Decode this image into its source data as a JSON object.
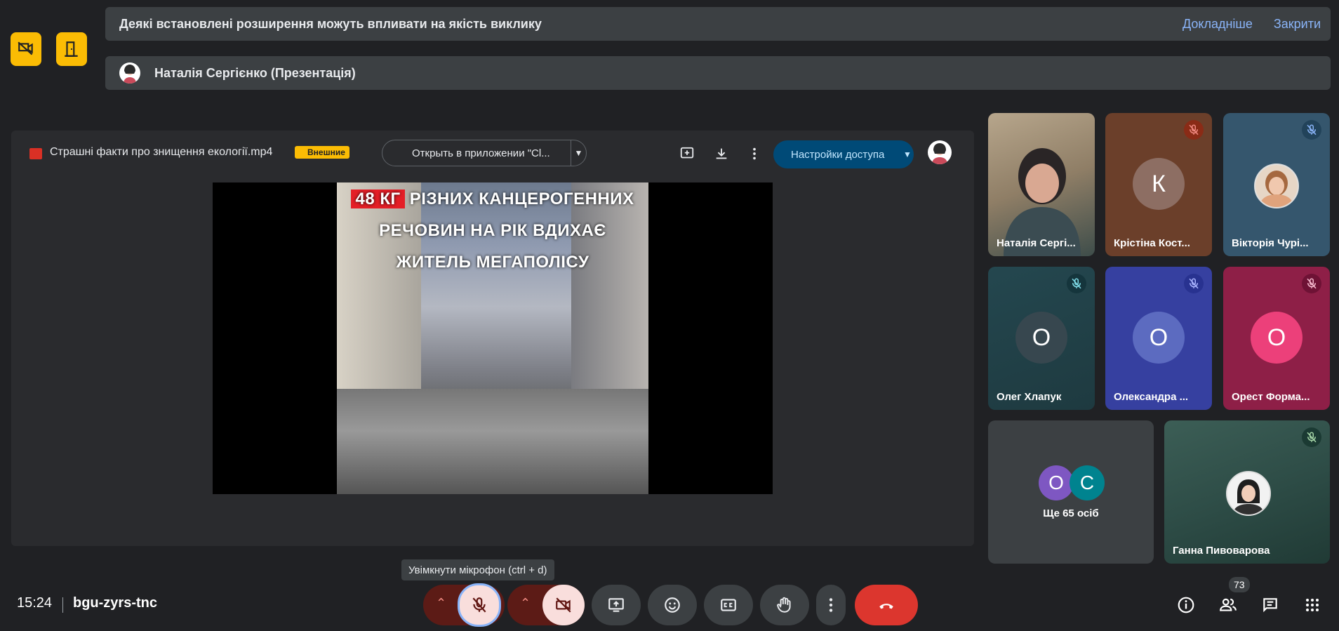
{
  "warning_banner": {
    "text": "Деякі встановлені розширення можуть впливати на якість виклику",
    "learn_more": "Докладніше",
    "close": "Закрити"
  },
  "presenter_banner": {
    "text": "Наталія Сергієнко (Презентація)"
  },
  "presentation": {
    "file_name": "Страшні факти про знищення екології.mp4",
    "badge": "Внешние",
    "open_app": "Открыть в приложении \"Cl...",
    "share_button": "Настройки доступа",
    "video_text": {
      "highlight": "48 КГ",
      "line1_rest": "РІЗНИХ КАНЦЕРОГЕННИХ",
      "line2": "РЕЧОВИН НА РІК ВДИХАЄ",
      "line3": "ЖИТЕЛЬ МЕГАПОЛІСУ"
    }
  },
  "participants": [
    {
      "name": "Наталія Сергі...",
      "type": "video"
    },
    {
      "name": "Крістіна Кост...",
      "initial": "К",
      "muted": true,
      "bg": "#6b3f2a",
      "avatar_bg": "#8d6e63"
    },
    {
      "name": "Вікторія Чурі...",
      "type": "photo",
      "muted": true,
      "bg": "#35566d"
    },
    {
      "name": "Олег Хлапук",
      "initial": "О",
      "muted": true,
      "bg": "#24474f",
      "avatar_bg": "#37474f"
    },
    {
      "name": "Олександра ...",
      "initial": "О",
      "muted": true,
      "bg": "#3640a0",
      "avatar_bg": "#5c6bc0"
    },
    {
      "name": "Орест Форма...",
      "initial": "О",
      "muted": true,
      "bg": "#8e1f47",
      "avatar_bg": "#ec407a"
    },
    {
      "name": "Ганна Пивоварова",
      "type": "photo",
      "muted": true,
      "bg": "#2e4d47"
    }
  ],
  "more_people": {
    "label": "Ще 65 осіб",
    "initials": [
      "О",
      "С"
    ],
    "colors": [
      "#7e57c2",
      "#00838f"
    ]
  },
  "bottom_bar": {
    "time": "15:24",
    "meeting_code": "bgu-zyrs-tnc",
    "mic_tooltip": "Увімкнути мікрофон (ctrl + d)",
    "participants_count": "73"
  }
}
